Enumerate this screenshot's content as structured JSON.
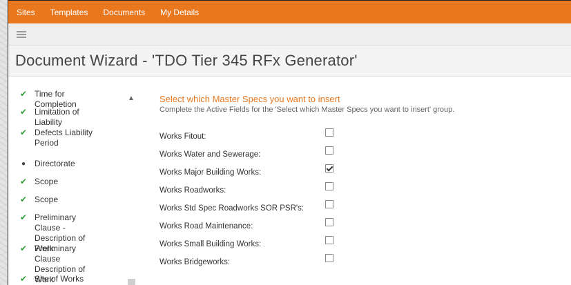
{
  "topnav": {
    "links": [
      "Sites",
      "Templates",
      "Documents",
      "My Details"
    ]
  },
  "toolbar": {
    "menu_icon": "hamburger-menu-icon"
  },
  "page": {
    "title": "Document Wizard - 'TDO Tier 345 RFx Generator'"
  },
  "sidebar": {
    "steps": [
      {
        "label": "Time for Completion",
        "status": "complete"
      },
      {
        "label": "Limitation of Liability",
        "status": "complete"
      },
      {
        "label": "Defects Liability Period",
        "status": "complete"
      },
      {
        "label": "Directorate",
        "status": "current"
      },
      {
        "label": "Scope",
        "status": "complete"
      },
      {
        "label": "Scope",
        "status": "complete"
      },
      {
        "label": "Preliminary Clause - Description of Work",
        "status": "complete"
      },
      {
        "label": "Preliminary Clause Description of Work",
        "status": "complete"
      },
      {
        "label": "Site of Works",
        "status": "complete"
      }
    ]
  },
  "main": {
    "heading": "Select which Master Specs you want to insert",
    "subheading": "Complete the Active Fields for the 'Select which Master Specs you want to insert' group.",
    "fields": [
      {
        "label": "Works Fitout:",
        "checked": false
      },
      {
        "label": "Works Water and Sewerage:",
        "checked": false
      },
      {
        "label": "Works Major Building Works:",
        "checked": true
      },
      {
        "label": "Works Roadworks:",
        "checked": false
      },
      {
        "label": "Works Std Spec Roadworks SOR PSR's:",
        "checked": false
      },
      {
        "label": "Works Road Maintenance:",
        "checked": false
      },
      {
        "label": "Works Small Building Works:",
        "checked": false
      },
      {
        "label": "Works Bridgeworks:",
        "checked": false
      }
    ]
  },
  "colors": {
    "brand": "#e8771e",
    "check": "#2e9e3a"
  }
}
